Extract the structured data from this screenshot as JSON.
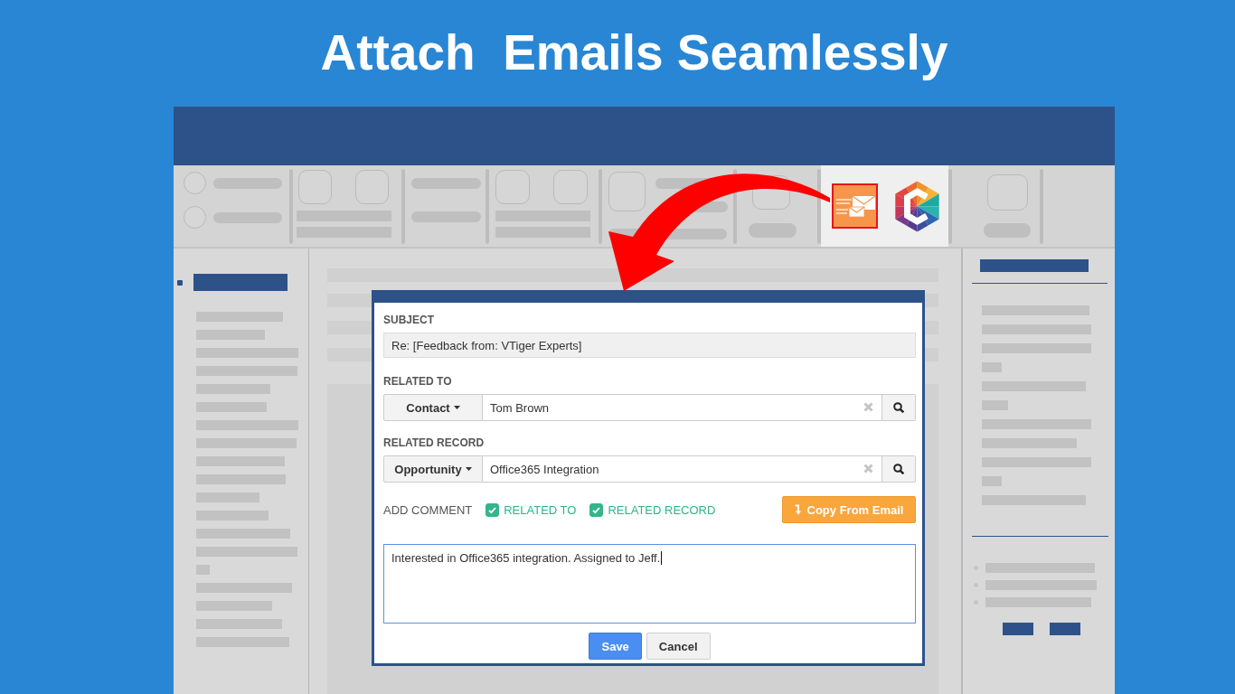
{
  "headline": "Attach  Emails Seamlessly",
  "toolbar": {
    "email_button": {
      "highlighted": true
    }
  },
  "dialog": {
    "subject": {
      "label": "SUBJECT",
      "value": "Re: [Feedback from: VTiger Experts]"
    },
    "related_to": {
      "label": "RELATED TO",
      "module": "Contact",
      "value": "Tom Brown"
    },
    "related_record": {
      "label": "RELATED RECORD",
      "module": "Opportunity",
      "value": "Office365 Integration"
    },
    "add_comment": {
      "label": "ADD COMMENT",
      "options": [
        {
          "label": "RELATED TO",
          "checked": true
        },
        {
          "label": "RELATED RECORD",
          "checked": true
        }
      ],
      "copy_button": "Copy From Email",
      "value": "Interested in Office365 integration. Assigned to Jeff."
    },
    "buttons": [
      {
        "label": "Save",
        "kind": "primary"
      },
      {
        "label": "Cancel",
        "kind": "secondary"
      }
    ]
  }
}
